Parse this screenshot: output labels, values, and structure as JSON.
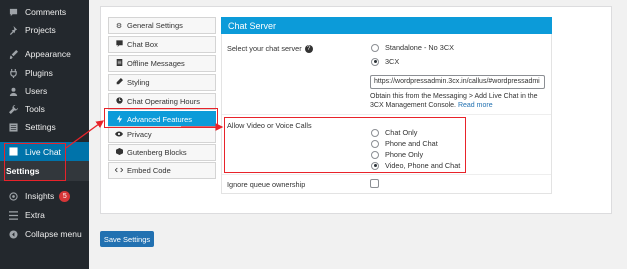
{
  "sidebar": {
    "items": [
      {
        "label": "Comments",
        "icon": "comment-icon"
      },
      {
        "label": "Projects",
        "icon": "pin-icon"
      },
      {
        "label": "Appearance",
        "icon": "brush-icon"
      },
      {
        "label": "Plugins",
        "icon": "plug-icon"
      },
      {
        "label": "Users",
        "icon": "user-icon"
      },
      {
        "label": "Tools",
        "icon": "wrench-icon"
      },
      {
        "label": "Settings",
        "icon": "settings-icon"
      },
      {
        "label": "Live Chat",
        "icon": "chat-icon"
      },
      {
        "label": "Settings",
        "icon": ""
      },
      {
        "label": "Insights",
        "icon": "insights-icon",
        "badge": "5"
      },
      {
        "label": "Extra",
        "icon": "extra-icon"
      },
      {
        "label": "Collapse menu",
        "icon": "collapse-icon"
      }
    ]
  },
  "tabs": [
    {
      "label": "General Settings",
      "icon": "gear-icon"
    },
    {
      "label": "Chat Box",
      "icon": "chat-box-icon"
    },
    {
      "label": "Offline Messages",
      "icon": "document-icon"
    },
    {
      "label": "Styling",
      "icon": "pencil-icon"
    },
    {
      "label": "Chat Operating Hours",
      "icon": "clock-icon"
    },
    {
      "label": "Advanced Features",
      "icon": "bolt-icon"
    },
    {
      "label": "Privacy",
      "icon": "eye-icon"
    },
    {
      "label": "Gutenberg Blocks",
      "icon": "cube-icon"
    },
    {
      "label": "Embed Code",
      "icon": "code-icon"
    }
  ],
  "section": {
    "title": "Chat Server",
    "server_label": "Select your chat server",
    "server_options": [
      "Standalone - No 3CX",
      "3CX"
    ],
    "url_value": "https://wordpressadmin.3cx.in/callus/#wordpressadmi",
    "help_text": "Obtain this from the Messaging > Add Live Chat in the 3CX Management Console.",
    "read_more": "Read more",
    "video_label": "Allow Video or Voice Calls",
    "video_options": [
      "Chat Only",
      "Phone and Chat",
      "Phone Only",
      "Video, Phone and Chat"
    ],
    "queue_label": "Ignore queue ownership"
  },
  "save_label": "Save Settings"
}
